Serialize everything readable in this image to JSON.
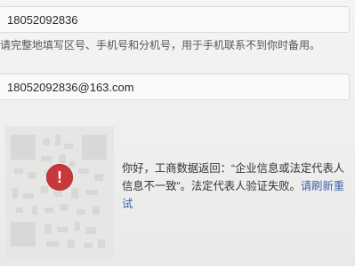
{
  "form": {
    "phone_value": "18052092836",
    "phone_hint": "请完整地填写区号、手机号和分机号，用于手机联系不到你时备用。",
    "email_value": "18052092836@163.com"
  },
  "error": {
    "message_main": "你好，工商数据返回：“企业信息或法定代表人信息不一致”。法定代表人验证失败。",
    "retry_label": "请刷新重试",
    "icon": "exclamation-icon",
    "accent_color": "#c8383b"
  }
}
